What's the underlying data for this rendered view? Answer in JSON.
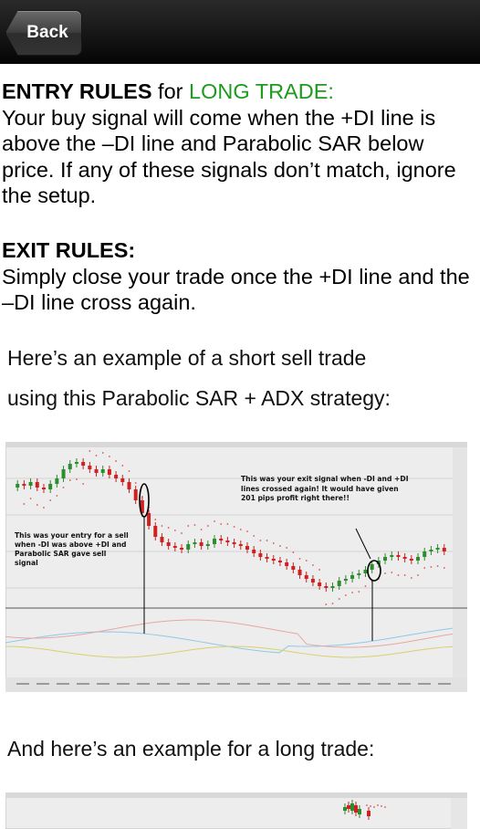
{
  "nav": {
    "back_label": "Back"
  },
  "entry": {
    "heading": "ENTRY RULES",
    "for_word": " for ",
    "trade_type": "LONG TRADE:",
    "text": "Your buy signal will come when the +DI line is above the –DI line and Parabolic SAR below price. If any of these signals don’t match, ignore the setup."
  },
  "exit": {
    "heading": "EXIT RULES:",
    "text": "Simply close your trade once the +DI line and the –DI line cross again."
  },
  "short_example": {
    "line1": "Here’s an example of a short sell trade",
    "line2": "using this Parabolic SAR + ADX strategy:"
  },
  "chart_annotations": {
    "entry_note": "This was your entry for a sell when -DI was above +DI and Parabolic SAR gave sell signal",
    "exit_note": "This was your exit signal when -DI and +DI lines crossed again! It would have given 201 pips profit right there!!"
  },
  "long_example": {
    "text": "And here’s an example for a long trade:"
  },
  "colors": {
    "green": "#1e9a1e",
    "bull_candle": "#2e8b2e",
    "bear_candle": "#cc2222",
    "sar_dots": "#e05050"
  }
}
